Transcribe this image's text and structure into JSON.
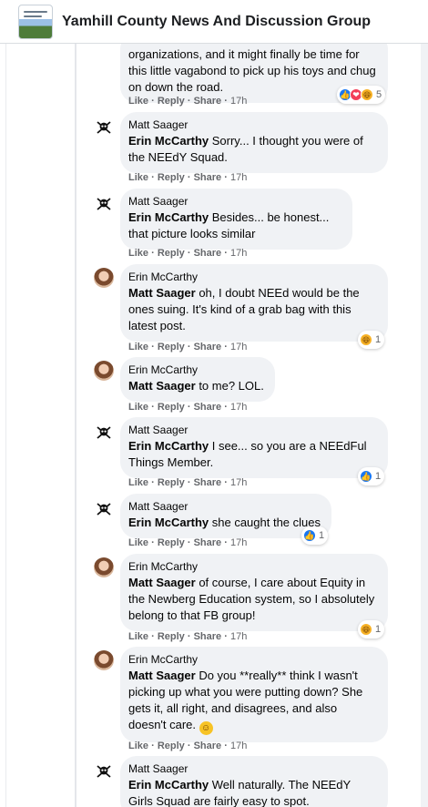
{
  "group": {
    "title": "Yamhill County News And Discussion Group"
  },
  "actions": {
    "like": "Like",
    "reply": "Reply",
    "share": "Share",
    "separator": "·"
  },
  "comments": [
    {
      "author": "",
      "mention": "",
      "text": "organizations, and it might finally be time for this little vagabond to pick up his toys and chug on down the road.",
      "time": "17h",
      "reactions": {
        "types": [
          "like",
          "love",
          "haha"
        ],
        "count": "5"
      }
    },
    {
      "author": "Matt Saager",
      "mention": "Erin McCarthy",
      "text": " Sorry... I thought you were of the NEEdY Squad.",
      "time": "17h"
    },
    {
      "author": "Matt Saager",
      "mention": "Erin McCarthy",
      "text": " Besides... be honest... that picture looks similar",
      "time": "17h"
    },
    {
      "author": "Erin McCarthy",
      "mention": "Matt Saager",
      "text": " oh, I doubt NEEd would be the ones suing. It's kind of a grab bag with this latest post.",
      "time": "17h",
      "reactions": {
        "types": [
          "haha"
        ],
        "count": "1"
      }
    },
    {
      "author": "Erin McCarthy",
      "mention": "Matt Saager",
      "text": " to me? LOL.",
      "time": "17h"
    },
    {
      "author": "Matt Saager",
      "mention": "Erin McCarthy",
      "text": " I see... so you are a NEEdFul Things Member.",
      "time": "17h",
      "reactions": {
        "types": [
          "like"
        ],
        "count": "1"
      }
    },
    {
      "author": "Matt Saager",
      "mention": "Erin McCarthy",
      "text": " she caught the clues",
      "time": "17h",
      "reactions": {
        "types": [
          "like"
        ],
        "count": "1"
      }
    },
    {
      "author": "Erin McCarthy",
      "mention": "Matt Saager",
      "text": " of course, I care about Equity in the Newberg Education system, so I absolutely belong to that FB group!",
      "time": "17h",
      "reactions": {
        "types": [
          "haha"
        ],
        "count": "1"
      }
    },
    {
      "author": "Erin McCarthy",
      "mention": "Matt Saager",
      "text": " Do you **really** think I wasn't picking up what you were putting down? She gets it, all right, and disagrees, and also doesn't care.",
      "emoji": "smile-emoji",
      "time": "17h"
    },
    {
      "author": "Matt Saager",
      "mention": "Erin McCarthy",
      "text": " Well naturally. The NEEdY Girls Squad are fairly easy to spot.",
      "time": ""
    }
  ]
}
